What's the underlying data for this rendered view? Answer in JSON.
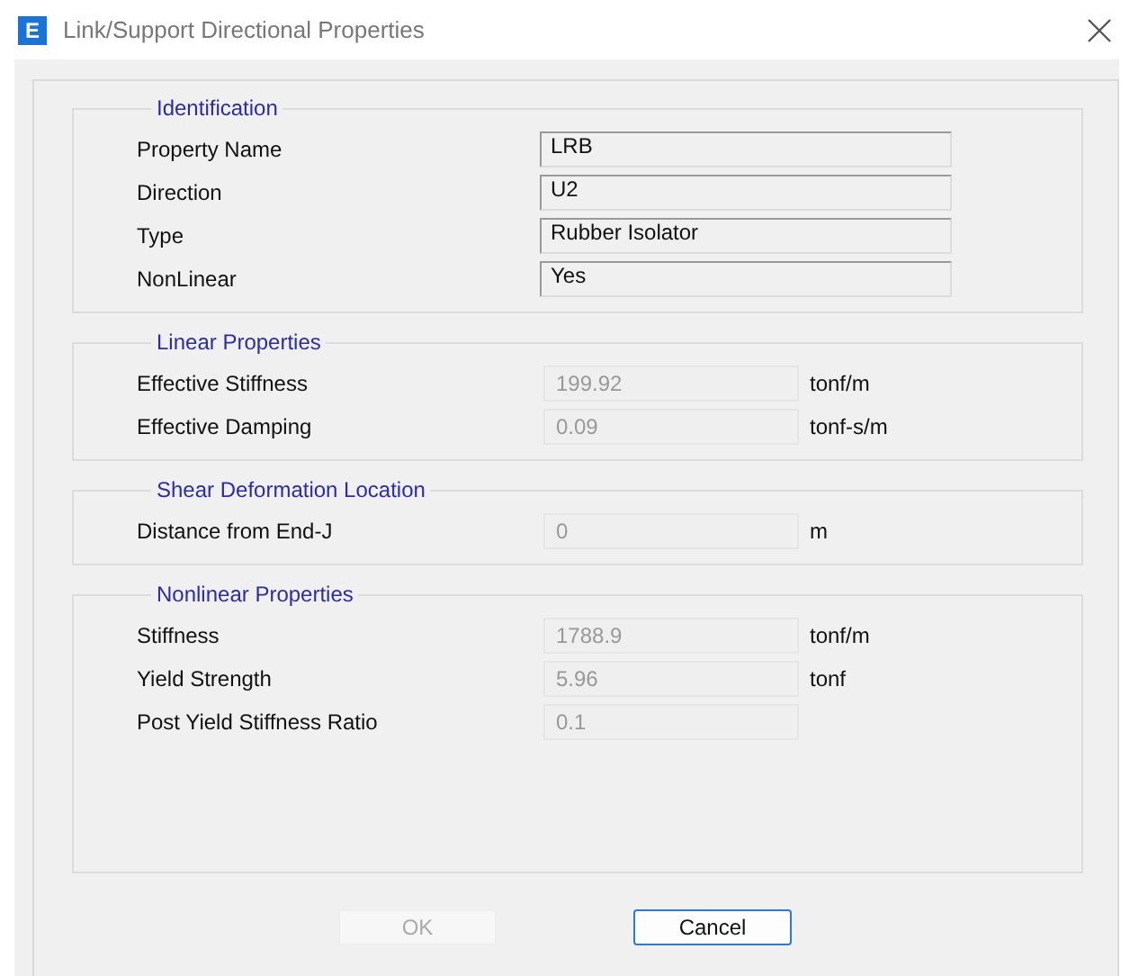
{
  "window": {
    "title": "Link/Support Directional Properties",
    "icon_text": "E"
  },
  "groups": [
    {
      "title": "Identification",
      "kind": "info",
      "rows": [
        {
          "label": "Property Name",
          "value": "LRB",
          "disabled": false
        },
        {
          "label": "Direction",
          "value": "U2",
          "disabled": false
        },
        {
          "label": "Type",
          "value": "Rubber Isolator",
          "disabled": false
        },
        {
          "label": "NonLinear",
          "value": "Yes",
          "disabled": false
        }
      ]
    },
    {
      "title": "Linear Properties",
      "kind": "numeric",
      "rows": [
        {
          "label": "Effective Stiffness",
          "value": "199.92",
          "unit": "tonf/m",
          "disabled": true
        },
        {
          "label": "Effective Damping",
          "value": "0.09",
          "unit": "tonf-s/m",
          "disabled": true
        }
      ]
    },
    {
      "title": "Shear Deformation Location",
      "kind": "numeric",
      "rows": [
        {
          "label": "Distance from End-J",
          "value": "0",
          "unit": "m",
          "disabled": true
        }
      ]
    },
    {
      "title": "Nonlinear Properties",
      "kind": "numeric",
      "rows": [
        {
          "label": "Stiffness",
          "value": "1788.9",
          "unit": "tonf/m",
          "disabled": true
        },
        {
          "label": "Yield Strength",
          "value": "5.96",
          "unit": "tonf",
          "disabled": true
        },
        {
          "label": "Post Yield Stiffness Ratio",
          "value": "0.1",
          "disabled": true
        }
      ]
    }
  ],
  "buttons": [
    {
      "label": "OK",
      "disabled": true,
      "default": false
    },
    {
      "label": "Cancel",
      "disabled": false,
      "default": true
    }
  ]
}
